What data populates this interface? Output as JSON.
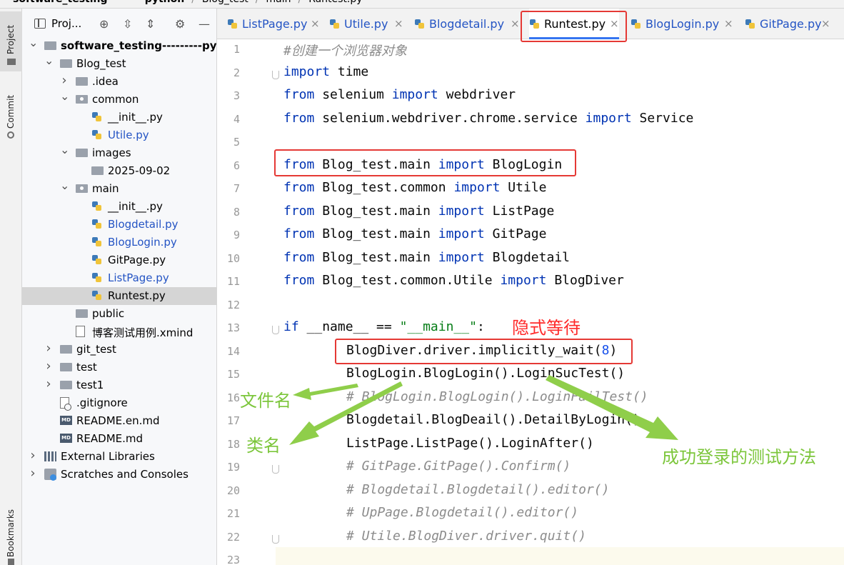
{
  "breadcrumb": {
    "items": [
      "software_testing---------python",
      "Blog_test",
      "main",
      "Runtest.py"
    ]
  },
  "toolstrip": {
    "project": "Project",
    "commit": "Commit",
    "bookmarks": "Bookmarks"
  },
  "project_panel": {
    "title": "Proj...",
    "tree": [
      {
        "label": "software_testing---------python",
        "indent": 0,
        "arrow": "down",
        "icon": "folder",
        "bold": true,
        "blue": false
      },
      {
        "label": "Blog_test",
        "indent": 1,
        "arrow": "down",
        "icon": "folder",
        "bold": false,
        "blue": false
      },
      {
        "label": ".idea",
        "indent": 2,
        "arrow": "right",
        "icon": "folder",
        "bold": false,
        "blue": false
      },
      {
        "label": "common",
        "indent": 2,
        "arrow": "down",
        "icon": "package",
        "bold": false,
        "blue": false
      },
      {
        "label": "__init__.py",
        "indent": 3,
        "arrow": "",
        "icon": "python",
        "bold": false,
        "blue": false
      },
      {
        "label": "Utile.py",
        "indent": 3,
        "arrow": "",
        "icon": "python",
        "bold": false,
        "blue": true
      },
      {
        "label": "images",
        "indent": 2,
        "arrow": "down",
        "icon": "folder",
        "bold": false,
        "blue": false
      },
      {
        "label": "2025-09-02",
        "indent": 3,
        "arrow": "",
        "icon": "folder",
        "bold": false,
        "blue": false
      },
      {
        "label": "main",
        "indent": 2,
        "arrow": "down",
        "icon": "package",
        "bold": false,
        "blue": false
      },
      {
        "label": "__init__.py",
        "indent": 3,
        "arrow": "",
        "icon": "python",
        "bold": false,
        "blue": false
      },
      {
        "label": "Blogdetail.py",
        "indent": 3,
        "arrow": "",
        "icon": "python",
        "bold": false,
        "blue": true
      },
      {
        "label": "BlogLogin.py",
        "indent": 3,
        "arrow": "",
        "icon": "python",
        "bold": false,
        "blue": true
      },
      {
        "label": "GitPage.py",
        "indent": 3,
        "arrow": "",
        "icon": "python",
        "bold": false,
        "blue": false
      },
      {
        "label": "ListPage.py",
        "indent": 3,
        "arrow": "",
        "icon": "python",
        "bold": false,
        "blue": true
      },
      {
        "label": "Runtest.py",
        "indent": 3,
        "arrow": "",
        "icon": "python",
        "bold": false,
        "blue": false,
        "selected": true
      },
      {
        "label": "public",
        "indent": 2,
        "arrow": "",
        "icon": "folder",
        "bold": false,
        "blue": false
      },
      {
        "label": "博客测试用例.xmind",
        "indent": 2,
        "arrow": "",
        "icon": "document",
        "bold": false,
        "blue": false
      },
      {
        "label": "git_test",
        "indent": 1,
        "arrow": "right",
        "icon": "folder",
        "bold": false,
        "blue": false
      },
      {
        "label": "test",
        "indent": 1,
        "arrow": "right",
        "icon": "folder",
        "bold": false,
        "blue": false
      },
      {
        "label": "test1",
        "indent": 1,
        "arrow": "right",
        "icon": "folder",
        "bold": false,
        "blue": false
      },
      {
        "label": ".gitignore",
        "indent": 1,
        "arrow": "",
        "icon": "gitignore",
        "bold": false,
        "blue": false
      },
      {
        "label": "README.en.md",
        "indent": 1,
        "arrow": "",
        "icon": "markdown",
        "bold": false,
        "blue": false
      },
      {
        "label": "README.md",
        "indent": 1,
        "arrow": "",
        "icon": "markdown",
        "bold": false,
        "blue": false
      },
      {
        "label": "External Libraries",
        "indent": 0,
        "arrow": "right",
        "icon": "library",
        "bold": false,
        "blue": false
      },
      {
        "label": "Scratches and Consoles",
        "indent": 0,
        "arrow": "right",
        "icon": "scratch",
        "bold": false,
        "blue": false
      }
    ]
  },
  "tabs": [
    {
      "label": "ListPage.py",
      "active": false
    },
    {
      "label": "Utile.py",
      "active": false
    },
    {
      "label": "Blogdetail.py",
      "active": false
    },
    {
      "label": "Runtest.py",
      "active": true
    },
    {
      "label": "BlogLogin.py",
      "active": false
    },
    {
      "label": "GitPage.py",
      "active": false
    }
  ],
  "editor": {
    "lines": [
      {
        "n": "1",
        "indent": 0,
        "tokens": [
          [
            "cmt",
            "#创建一个浏览器对象"
          ]
        ]
      },
      {
        "n": "2",
        "indent": 0,
        "tokens": [
          [
            "kw",
            "import"
          ],
          [
            "",
            " time"
          ]
        ]
      },
      {
        "n": "3",
        "indent": 0,
        "tokens": [
          [
            "kw",
            "from"
          ],
          [
            "",
            " selenium "
          ],
          [
            "kw",
            "import"
          ],
          [
            "",
            " webdriver"
          ]
        ]
      },
      {
        "n": "4",
        "indent": 0,
        "tokens": [
          [
            "kw",
            "from"
          ],
          [
            "",
            " selenium.webdriver.chrome.service "
          ],
          [
            "kw",
            "import"
          ],
          [
            "",
            " Service"
          ]
        ]
      },
      {
        "n": "5",
        "indent": 0,
        "tokens": []
      },
      {
        "n": "6",
        "indent": 0,
        "tokens": [
          [
            "kw",
            "from"
          ],
          [
            "",
            " Blog_test.main "
          ],
          [
            "kw",
            "import"
          ],
          [
            "",
            " BlogLogin"
          ]
        ]
      },
      {
        "n": "7",
        "indent": 0,
        "tokens": [
          [
            "kw",
            "from"
          ],
          [
            "",
            " Blog_test.common "
          ],
          [
            "kw",
            "import"
          ],
          [
            "",
            " Utile"
          ]
        ]
      },
      {
        "n": "8",
        "indent": 0,
        "tokens": [
          [
            "kw",
            "from"
          ],
          [
            "",
            " Blog_test.main "
          ],
          [
            "kw",
            "import"
          ],
          [
            "",
            " ListPage"
          ]
        ]
      },
      {
        "n": "9",
        "indent": 0,
        "tokens": [
          [
            "kw",
            "from"
          ],
          [
            "",
            " Blog_test.main "
          ],
          [
            "kw",
            "import"
          ],
          [
            "",
            " GitPage"
          ]
        ]
      },
      {
        "n": "10",
        "indent": 0,
        "tokens": [
          [
            "kw",
            "from"
          ],
          [
            "",
            " Blog_test.main "
          ],
          [
            "kw",
            "import"
          ],
          [
            "",
            " Blogdetail"
          ]
        ]
      },
      {
        "n": "11",
        "indent": 0,
        "tokens": [
          [
            "kw",
            "from"
          ],
          [
            "",
            " Blog_test.common.Utile "
          ],
          [
            "kw",
            "import"
          ],
          [
            "",
            " BlogDiver"
          ]
        ]
      },
      {
        "n": "12",
        "indent": 0,
        "tokens": []
      },
      {
        "n": "13",
        "indent": 0,
        "tokens": [
          [
            "kw",
            "if"
          ],
          [
            "",
            " __name__ == "
          ],
          [
            "str",
            "\"__main__\""
          ],
          [
            "",
            ":"
          ]
        ]
      },
      {
        "n": "14",
        "indent": 1,
        "tokens": [
          [
            "",
            "BlogDiver.driver.implicitly_wait("
          ],
          [
            "num",
            "8"
          ],
          [
            "",
            ")"
          ]
        ]
      },
      {
        "n": "15",
        "indent": 1,
        "tokens": [
          [
            "",
            "BlogLogin.BlogLogin().LoginSucTest()"
          ]
        ]
      },
      {
        "n": "16",
        "indent": 1,
        "tokens": [
          [
            "cmt",
            "# BlogLogin.BlogLogin().LoginFailTest()"
          ]
        ]
      },
      {
        "n": "17",
        "indent": 1,
        "tokens": [
          [
            "",
            "Blogdetail.BlogDeail().DetailByLogin()"
          ]
        ]
      },
      {
        "n": "18",
        "indent": 1,
        "tokens": [
          [
            "",
            "ListPage.ListPage().LoginAfter()"
          ]
        ]
      },
      {
        "n": "19",
        "indent": 1,
        "tokens": [
          [
            "cmt",
            "# GitPage.GitPage().Confirm()"
          ]
        ]
      },
      {
        "n": "20",
        "indent": 1,
        "tokens": [
          [
            "cmt",
            "# Blogdetail.Blogdetail().editor()"
          ]
        ]
      },
      {
        "n": "21",
        "indent": 1,
        "tokens": [
          [
            "cmt",
            "# UpPage.Blogdetail().editor()"
          ]
        ]
      },
      {
        "n": "22",
        "indent": 1,
        "tokens": [
          [
            "cmt",
            "# Utile.BlogDiver.driver.quit()"
          ]
        ]
      },
      {
        "n": "23",
        "indent": 0,
        "tokens": []
      }
    ]
  },
  "annotations": {
    "implicit_wait": "隐式等待",
    "file_name": "文件名",
    "class_name": "类名",
    "success_login_test": "成功登录的测试方法"
  },
  "colors": {
    "highlight_red": "#e53935",
    "annotation_red": "#ff2a2a",
    "annotation_green": "#7cc63b",
    "keyword": "#0033b3",
    "string": "#067d17",
    "comment": "#8c8c8c",
    "modified_file_blue": "#2454c4"
  }
}
